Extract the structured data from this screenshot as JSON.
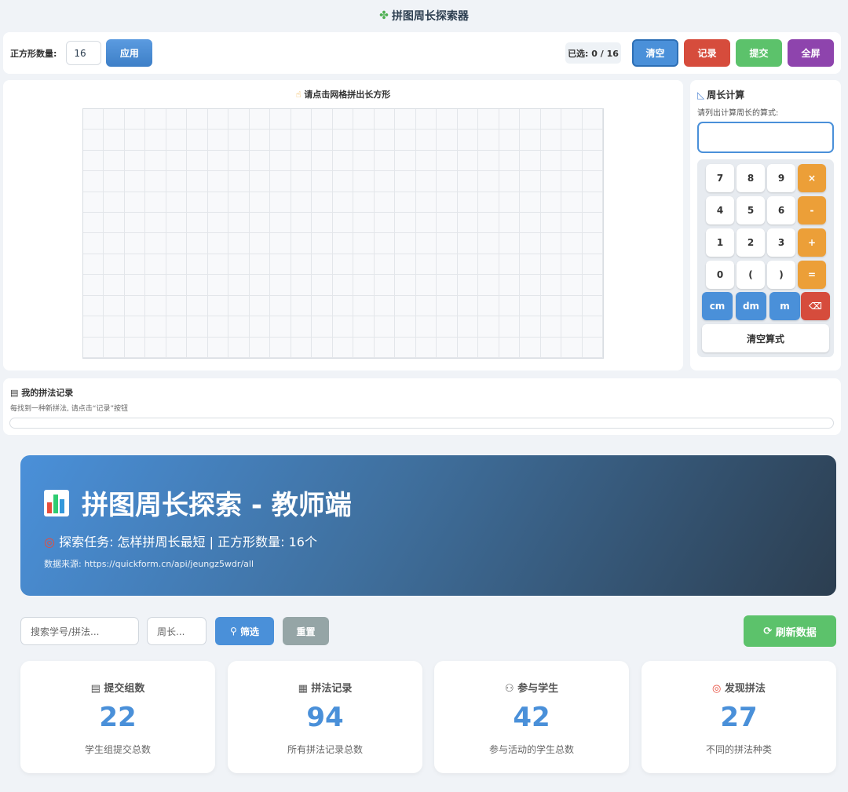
{
  "app": {
    "title": "拼图周长探索器"
  },
  "toolbar": {
    "count_label": "正方形数量:",
    "count_value": "16",
    "apply_label": "应用",
    "selected": "已选: 0 / 16",
    "clear_label": "清空",
    "record_label": "记录",
    "submit_label": "提交",
    "fullscreen_label": "全屏"
  },
  "grid": {
    "title": "请点击网格拼出长方形",
    "columns": 25,
    "rows": 12
  },
  "calculator": {
    "title": "周长计算",
    "hint": "请列出计算周长的算式:",
    "formula_value": "",
    "keys": [
      "7",
      "8",
      "9",
      "×",
      "4",
      "5",
      "6",
      "-",
      "1",
      "2",
      "3",
      "+",
      "0",
      "(",
      ")",
      "="
    ],
    "units": [
      "cm",
      "dm",
      "m"
    ],
    "backspace": "⌫",
    "clear_label": "清空算式"
  },
  "records": {
    "title": "我的拼法记录",
    "hint": "每找到一种新拼法, 请点击“记录”按钮"
  },
  "teacher": {
    "title": "拼图周长探索 - 教师端",
    "task": "探索任务: 怎样拼周长最短 | 正方形数量: 16个",
    "source": "数据来源: https://quickform.cn/api/jeungz5wdr/all"
  },
  "filters": {
    "search_placeholder": "搜索学号/拼法...",
    "perimeter_placeholder": "周长...",
    "filter_label": "筛选",
    "reset_label": "重置",
    "refresh_label": "刷新数据"
  },
  "stats": [
    {
      "title": "提交组数",
      "value": "22",
      "desc": "学生组提交总数"
    },
    {
      "title": "拼法记录",
      "value": "94",
      "desc": "所有拼法记录总数"
    },
    {
      "title": "参与学生",
      "value": "42",
      "desc": "参与活动的学生总数"
    },
    {
      "title": "发现拼法",
      "value": "27",
      "desc": "不同的拼法种类"
    }
  ]
}
